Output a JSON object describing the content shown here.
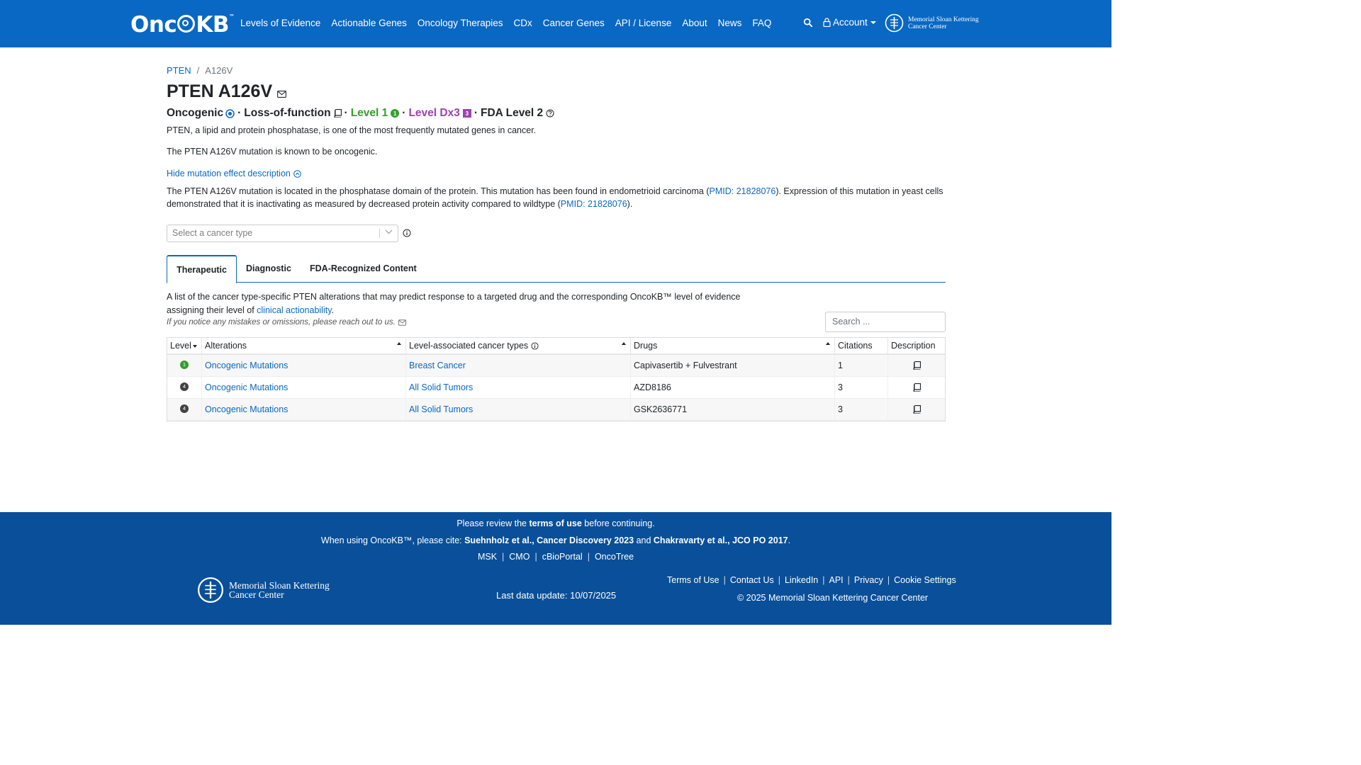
{
  "nav": {
    "logo_pre": "Onc",
    "logo_post": "KB",
    "logo_tm": "™",
    "links": [
      "Levels of Evidence",
      "Actionable Genes",
      "Oncology Therapies",
      "CDx",
      "Cancer Genes",
      "API / License",
      "About",
      "News",
      "FAQ"
    ],
    "account_label": "Account",
    "msk_line1": "Memorial Sloan Kettering",
    "msk_line2": "Cancer Center"
  },
  "breadcrumb": {
    "gene": "PTEN",
    "sep": "/",
    "alteration": "A126V"
  },
  "title": "PTEN A126V",
  "summary": {
    "oncogenic": "Oncogenic",
    "effect": "Loss-of-function",
    "level1": "Level 1",
    "level1_badge": "1",
    "leveldx": "Level Dx3",
    "leveldx_badge": "3",
    "fda_level": "FDA Level 2",
    "dot": "·"
  },
  "gene_summary": "PTEN, a lipid and protein phosphatase, is one of the most frequently mutated genes in cancer.",
  "variant_summary": "The PTEN A126V mutation is known to be oncogenic.",
  "hide_link": "Hide mutation effect description",
  "effect_desc": {
    "part1": "The PTEN A126V mutation is located in the phosphatase domain of the protein. This mutation has been found in endometrioid carcinoma (",
    "pmid1": "PMID: 21828076",
    "part2": "). Expression of this mutation in yeast cells demonstrated that it is inactivating as measured by decreased protein activity compared to wildtype (",
    "pmid2": "PMID: 21828076",
    "part3": ")."
  },
  "select": {
    "placeholder": "Select a cancer type"
  },
  "tabs": [
    "Therapeutic",
    "Diagnostic",
    "FDA-Recognized Content"
  ],
  "therapeutic": {
    "desc_part1": "A list of the cancer type-specific PTEN alterations that may predict response to a targeted drug and the corresponding OncoKB™ level of evidence assigning their level of ",
    "desc_link": "clinical actionability",
    "desc_part2": ".",
    "note": "If you notice any mistakes or omissions, please reach out to us.",
    "search_placeholder": "Search ..."
  },
  "table": {
    "headers": [
      "Level",
      "Alterations",
      "Level-associated cancer types",
      "Drugs",
      "Citations",
      "Description"
    ],
    "rows": [
      {
        "level": "1",
        "alteration": "Oncogenic Mutations",
        "cancer_type": "Breast Cancer",
        "drugs": "Capivasertib + Fulvestrant",
        "citations": "1"
      },
      {
        "level": "4",
        "alteration": "Oncogenic Mutations",
        "cancer_type": "All Solid Tumors",
        "drugs": "AZD8186",
        "citations": "3"
      },
      {
        "level": "4",
        "alteration": "Oncogenic Mutations",
        "cancer_type": "All Solid Tumors",
        "drugs": "GSK2636771",
        "citations": "3"
      }
    ]
  },
  "footer": {
    "review_pre": "Please review the ",
    "review_bold": "terms of use",
    "review_post": " before continuing.",
    "cite_pre": "When using OncoKB™, please cite: ",
    "cite_1": "Suehnholz et al., Cancer Discovery 2023",
    "cite_and": " and ",
    "cite_2": "Chakravarty et al., JCO PO 2017",
    "cite_end": ".",
    "links": [
      "MSK",
      "CMO",
      "cBioPortal",
      "OncoTree"
    ],
    "msk_line1": "Memorial Sloan Kettering",
    "msk_line2": "Cancer Center",
    "last_update": "Last data update: 10/07/2025",
    "right_links": [
      "Terms of Use",
      "Contact Us",
      "LinkedIn",
      "API",
      "Privacy",
      "Cookie Settings"
    ],
    "copyright": "© 2025 Memorial Sloan Kettering Cancer Center"
  },
  "colors": {
    "brand": "#0968c3",
    "footer": "#0a4f99",
    "level1": "#33a02c",
    "level4": "#424242",
    "dx": "#9b42ad"
  }
}
